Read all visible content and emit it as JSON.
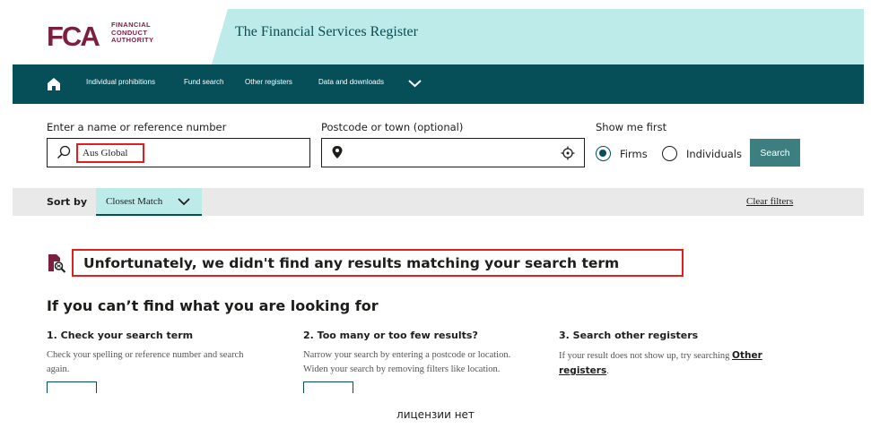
{
  "brand": {
    "logo_letters": "FCA",
    "logo_words": [
      "FINANCIAL",
      "CONDUCT",
      "AUTHORITY"
    ],
    "color": "#7b1f3f"
  },
  "banner": {
    "title": "The Financial Services Register",
    "color": "#bdebea"
  },
  "nav": {
    "home_icon": "home-icon",
    "items": [
      "Individual prohibitions",
      "Fund search",
      "Other registers",
      "Data and downloads"
    ],
    "color": "#064f58"
  },
  "search": {
    "name_label": "Enter a name or reference number",
    "name_value": "Aus Global",
    "location_label": "Postcode or town (optional)",
    "location_value": "",
    "show_first_label": "Show me first",
    "options": [
      "Firms",
      "Individuals"
    ],
    "selected": "Firms",
    "button": "Search"
  },
  "sort": {
    "label": "Sort by",
    "value": "Closest Match",
    "clear": "Clear filters"
  },
  "result": {
    "message": "Unfortunately, we didn't find any results matching your search term"
  },
  "help": {
    "heading": "If you can’t find what you are looking for",
    "columns": [
      {
        "title": "1. Check your search term",
        "line1": "Check your spelling or reference number and search",
        "line2": "again."
      },
      {
        "title": "2. Too many or too few results?",
        "line1": "Narrow your search by entering a postcode or location.",
        "line2": "Widen your search by removing filters like location."
      },
      {
        "title": "3. Search other registers",
        "line1": "If your result does not show up, try searching",
        "link1": "Other",
        "link2": "registers",
        "line2_suffix": "."
      }
    ]
  },
  "caption": "лицензии нет"
}
